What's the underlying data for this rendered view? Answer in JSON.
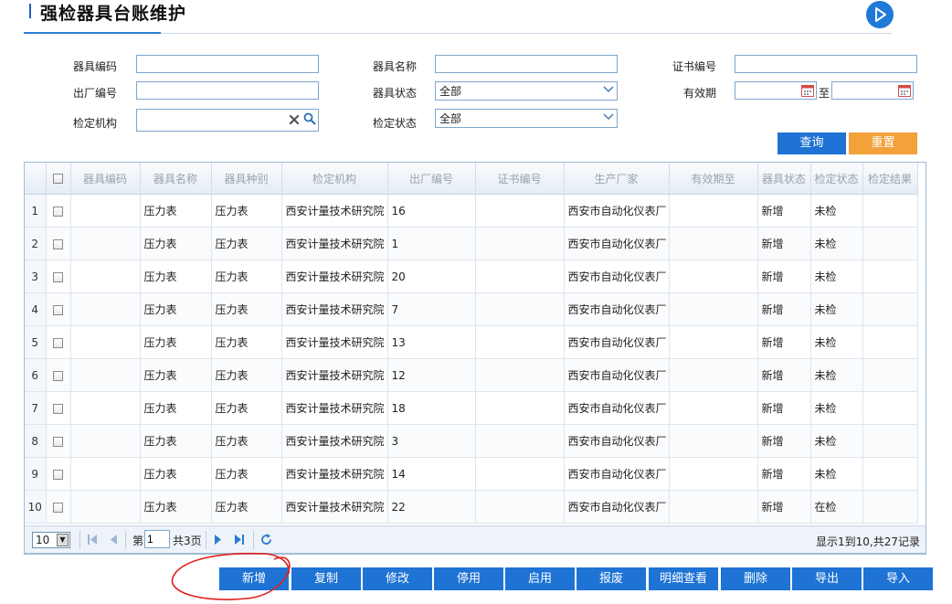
{
  "page": {
    "title": "强检器具台账维护"
  },
  "filters": {
    "code_label": "器具编码",
    "name_label": "器具名称",
    "cert_label": "证书编号",
    "factory_no_label": "出厂编号",
    "status_label": "器具状态",
    "status_value": "全部",
    "valid_label": "有效期",
    "to_label": "至",
    "org_label": "检定机构",
    "verify_status_label": "检定状态",
    "verify_status_value": "全部",
    "query_button": "查询",
    "reset_button": "重置"
  },
  "table": {
    "columns": [
      "器具编码",
      "器具名称",
      "器具种别",
      "检定机构",
      "出厂编号",
      "证书编号",
      "生产厂家",
      "有效期至",
      "器具状态",
      "检定状态",
      "检定结果"
    ],
    "rows": [
      {
        "no": "1",
        "code": "",
        "name": "压力表",
        "kind": "压力表",
        "org": "西安计量技术研究院",
        "factory_no": "16",
        "cert": "",
        "maker": "西安市自动化仪表厂",
        "valid": "",
        "status": "新增",
        "verify": "未检",
        "result": ""
      },
      {
        "no": "2",
        "code": "",
        "name": "压力表",
        "kind": "压力表",
        "org": "西安计量技术研究院",
        "factory_no": "1",
        "cert": "",
        "maker": "西安市自动化仪表厂",
        "valid": "",
        "status": "新增",
        "verify": "未检",
        "result": ""
      },
      {
        "no": "3",
        "code": "",
        "name": "压力表",
        "kind": "压力表",
        "org": "西安计量技术研究院",
        "factory_no": "20",
        "cert": "",
        "maker": "西安市自动化仪表厂",
        "valid": "",
        "status": "新增",
        "verify": "未检",
        "result": ""
      },
      {
        "no": "4",
        "code": "",
        "name": "压力表",
        "kind": "压力表",
        "org": "西安计量技术研究院",
        "factory_no": "7",
        "cert": "",
        "maker": "西安市自动化仪表厂",
        "valid": "",
        "status": "新增",
        "verify": "未检",
        "result": ""
      },
      {
        "no": "5",
        "code": "",
        "name": "压力表",
        "kind": "压力表",
        "org": "西安计量技术研究院",
        "factory_no": "13",
        "cert": "",
        "maker": "西安市自动化仪表厂",
        "valid": "",
        "status": "新增",
        "verify": "未检",
        "result": ""
      },
      {
        "no": "6",
        "code": "",
        "name": "压力表",
        "kind": "压力表",
        "org": "西安计量技术研究院",
        "factory_no": "12",
        "cert": "",
        "maker": "西安市自动化仪表厂",
        "valid": "",
        "status": "新增",
        "verify": "未检",
        "result": ""
      },
      {
        "no": "7",
        "code": "",
        "name": "压力表",
        "kind": "压力表",
        "org": "西安计量技术研究院",
        "factory_no": "18",
        "cert": "",
        "maker": "西安市自动化仪表厂",
        "valid": "",
        "status": "新增",
        "verify": "未检",
        "result": ""
      },
      {
        "no": "8",
        "code": "",
        "name": "压力表",
        "kind": "压力表",
        "org": "西安计量技术研究院",
        "factory_no": "3",
        "cert": "",
        "maker": "西安市自动化仪表厂",
        "valid": "",
        "status": "新增",
        "verify": "未检",
        "result": ""
      },
      {
        "no": "9",
        "code": "",
        "name": "压力表",
        "kind": "压力表",
        "org": "西安计量技术研究院",
        "factory_no": "14",
        "cert": "",
        "maker": "西安市自动化仪表厂",
        "valid": "",
        "status": "新增",
        "verify": "未检",
        "result": ""
      },
      {
        "no": "10",
        "code": "",
        "name": "压力表",
        "kind": "压力表",
        "org": "西安计量技术研究院",
        "factory_no": "22",
        "cert": "",
        "maker": "西安市自动化仪表厂",
        "valid": "",
        "status": "新增",
        "verify": "在检",
        "result": ""
      }
    ]
  },
  "pager": {
    "page_size": "10",
    "page_prefix": "第",
    "page_value": "1",
    "total_pages": "共3页",
    "info": "显示1到10,共27记录"
  },
  "actions": [
    "新增",
    "复制",
    "修改",
    "停用",
    "启用",
    "报废",
    "明细查看",
    "删除",
    "导出",
    "导入"
  ],
  "colors": {
    "primary": "#1e73d4",
    "reset": "#f2a13b",
    "annotation": "#e02020"
  },
  "icons": {
    "play": "play-circle-icon",
    "clear": "clear-icon",
    "search": "search-icon",
    "calendar": "calendar-icon"
  }
}
